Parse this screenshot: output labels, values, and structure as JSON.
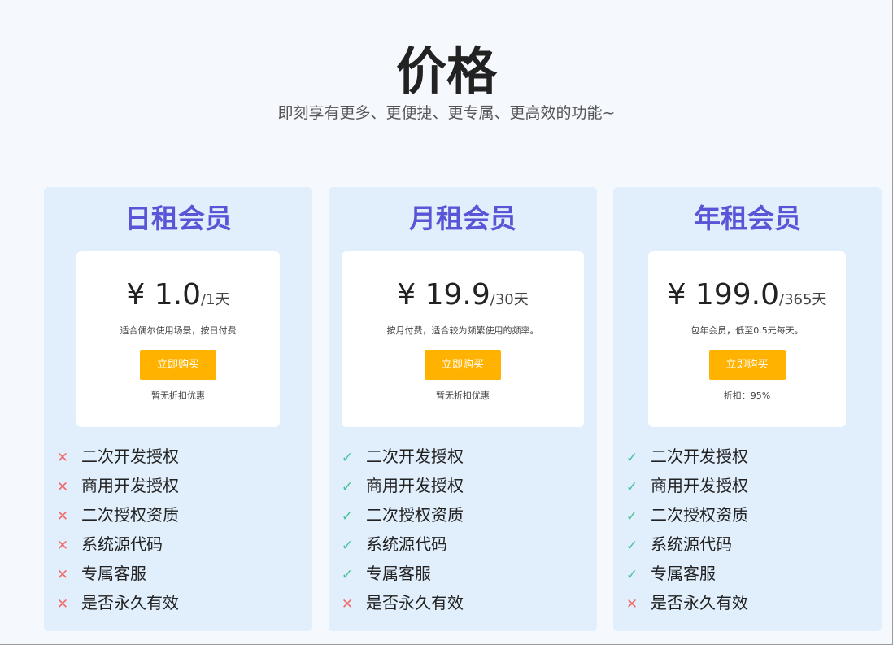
{
  "header": {
    "title": "价格",
    "subtitle": "即刻享有更多、更便捷、更专属、更高效的功能~"
  },
  "colors": {
    "plan_name": "#5a55d6",
    "buy_button": "#ffb200",
    "card_background": "#e1eefc",
    "check": "#43c39a",
    "cross": "#f06a6a"
  },
  "icons": {
    "included": "check-icon",
    "excluded": "cross-icon"
  },
  "plans": [
    {
      "name": "日租会员",
      "price": "¥ 1.0",
      "unit": "/1天",
      "description": "适合偶尔使用场景，按日付费",
      "button_label": "立即购买",
      "discount": "暂无折扣优惠",
      "features": [
        {
          "label": "二次开发授权",
          "included": false
        },
        {
          "label": "商用开发授权",
          "included": false
        },
        {
          "label": "二次授权资质",
          "included": false
        },
        {
          "label": "系统源代码",
          "included": false
        },
        {
          "label": "专属客服",
          "included": false
        },
        {
          "label": "是否永久有效",
          "included": false
        }
      ]
    },
    {
      "name": "月租会员",
      "price": "¥ 19.9",
      "unit": "/30天",
      "description": "按月付费，适合较为频繁使用的频率。",
      "button_label": "立即购买",
      "discount": "暂无折扣优惠",
      "features": [
        {
          "label": "二次开发授权",
          "included": true
        },
        {
          "label": "商用开发授权",
          "included": true
        },
        {
          "label": "二次授权资质",
          "included": true
        },
        {
          "label": "系统源代码",
          "included": true
        },
        {
          "label": "专属客服",
          "included": true
        },
        {
          "label": "是否永久有效",
          "included": false
        }
      ]
    },
    {
      "name": "年租会员",
      "price": "¥ 199.0",
      "unit": "/365天",
      "description": "包年会员，低至0.5元每天。",
      "button_label": "立即购买",
      "discount": "折扣：95%",
      "features": [
        {
          "label": "二次开发授权",
          "included": true
        },
        {
          "label": "商用开发授权",
          "included": true
        },
        {
          "label": "二次授权资质",
          "included": true
        },
        {
          "label": "系统源代码",
          "included": true
        },
        {
          "label": "专属客服",
          "included": true
        },
        {
          "label": "是否永久有效",
          "included": false
        }
      ]
    }
  ]
}
